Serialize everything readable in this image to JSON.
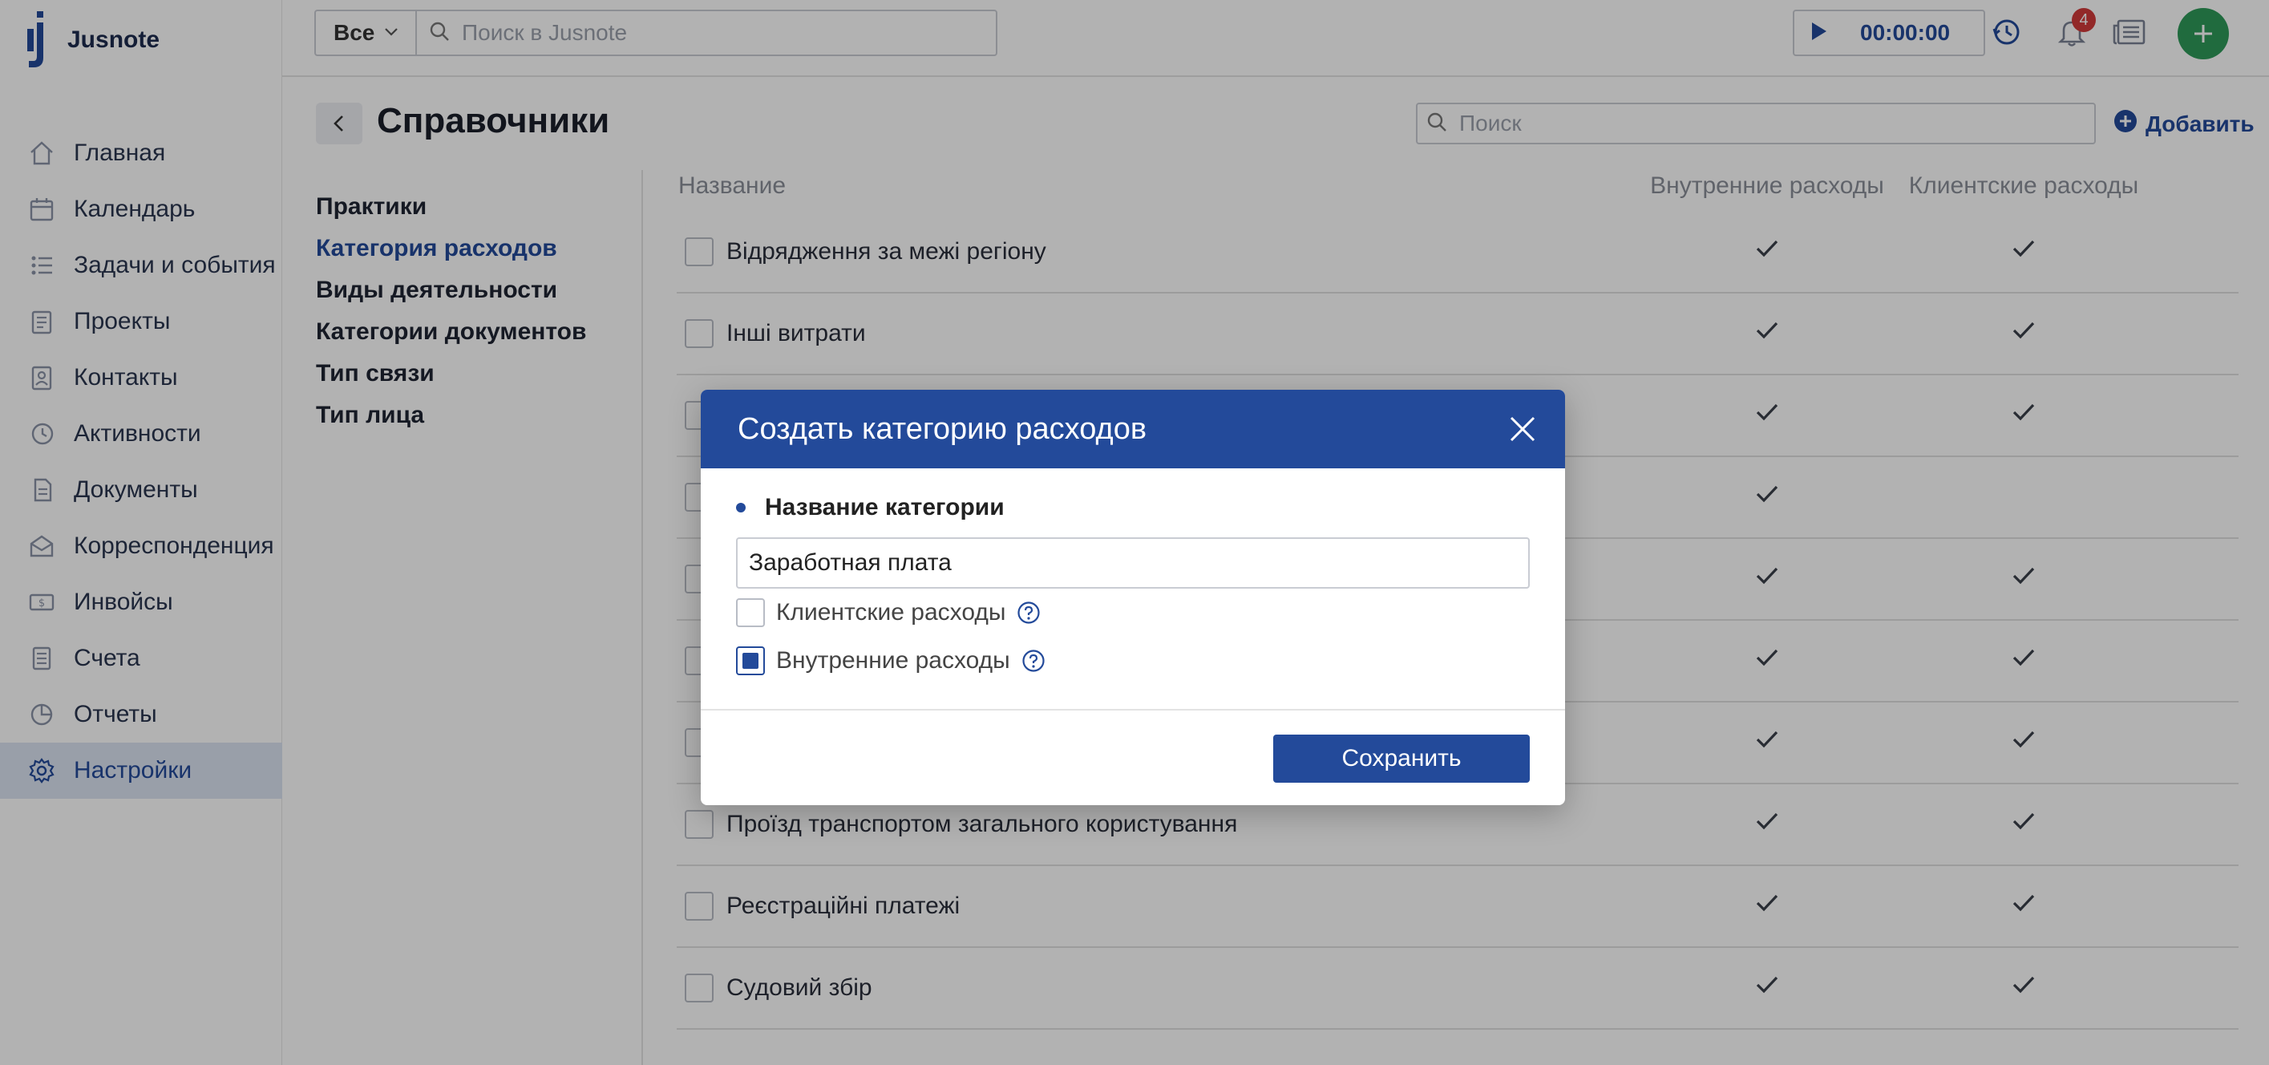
{
  "app": {
    "name": "Jusnote",
    "accent": "#234a9a",
    "fab_color": "#2e9a5a"
  },
  "sidebar": {
    "items": [
      {
        "label": "Главная",
        "icon": "home-icon"
      },
      {
        "label": "Календарь",
        "icon": "calendar-icon"
      },
      {
        "label": "Задачи и события",
        "icon": "tasks-icon"
      },
      {
        "label": "Проекты",
        "icon": "projects-icon"
      },
      {
        "label": "Контакты",
        "icon": "contacts-icon"
      },
      {
        "label": "Активности",
        "icon": "activity-icon"
      },
      {
        "label": "Документы",
        "icon": "documents-icon"
      },
      {
        "label": "Корреспонденция",
        "icon": "mail-icon"
      },
      {
        "label": "Инвойсы",
        "icon": "invoice-icon"
      },
      {
        "label": "Счета",
        "icon": "accounts-icon"
      },
      {
        "label": "Отчеты",
        "icon": "reports-icon"
      },
      {
        "label": "Настройки",
        "icon": "settings-icon"
      }
    ],
    "active_index": 11
  },
  "topbar": {
    "scope": "Все",
    "search_placeholder": "Поиск в Jusnote",
    "timer": "00:00:00",
    "notifications_count": "4"
  },
  "page": {
    "title": "Справочники",
    "search_placeholder": "Поиск",
    "add_label": "Добавить"
  },
  "submenu": {
    "items": [
      "Практики",
      "Категория расходов",
      "Виды деятельности",
      "Категории документов",
      "Тип связи",
      "Тип лица"
    ],
    "active_index": 1
  },
  "table": {
    "headers": {
      "name": "Название",
      "internal": "Внутренние расходы",
      "client": "Клиентские расходы"
    },
    "rows": [
      {
        "name": "Відрядження за межі регіону",
        "internal": true,
        "client": true
      },
      {
        "name": "Інші витрати",
        "internal": true,
        "client": true
      },
      {
        "name": "",
        "internal": true,
        "client": true
      },
      {
        "name": "",
        "internal": true,
        "client": false
      },
      {
        "name": "",
        "internal": true,
        "client": true
      },
      {
        "name": "",
        "internal": true,
        "client": true
      },
      {
        "name": "",
        "internal": true,
        "client": true
      },
      {
        "name": "Проїзд транспортом загального користування",
        "internal": true,
        "client": true
      },
      {
        "name": "Реєстраційні платежі",
        "internal": true,
        "client": true
      },
      {
        "name": "Судовий збір",
        "internal": true,
        "client": true
      }
    ]
  },
  "modal": {
    "title": "Создать категорию расходов",
    "field_label": "Название категории",
    "field_value": "Заработная плата",
    "client_expenses_label": "Клиентские расходы",
    "client_expenses_checked": false,
    "internal_expenses_label": "Внутренние расходы",
    "internal_expenses_checked": true,
    "save_label": "Сохранить"
  }
}
